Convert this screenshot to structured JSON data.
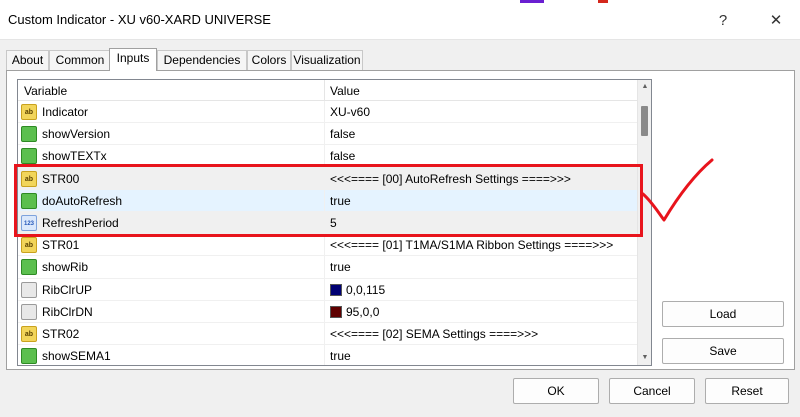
{
  "window": {
    "title": "Custom Indicator - XU v60-XARD UNIVERSE",
    "help_glyph": "?",
    "close_glyph": "✕"
  },
  "tabs": [
    {
      "label": "About"
    },
    {
      "label": "Common"
    },
    {
      "label": "Inputs"
    },
    {
      "label": "Dependencies"
    },
    {
      "label": "Colors"
    },
    {
      "label": "Visualization"
    }
  ],
  "active_tab": "Inputs",
  "grid": {
    "col_variable": "Variable",
    "col_value": "Value",
    "rows": [
      {
        "icon": "ab",
        "name": "Indicator",
        "value": "XU-v60"
      },
      {
        "icon": "bool",
        "name": "showVersion",
        "value": "false"
      },
      {
        "icon": "bool",
        "name": "showTEXTx",
        "value": "false"
      },
      {
        "icon": "ab",
        "name": "STR00",
        "value": "<<<==== [00] AutoRefresh Settings ====>>>"
      },
      {
        "icon": "bool",
        "name": "doAutoRefresh",
        "value": "true"
      },
      {
        "icon": "num",
        "name": "RefreshPeriod",
        "value": "5"
      },
      {
        "icon": "ab",
        "name": "STR01",
        "value": "<<<==== [01] T1MA/S1MA Ribbon Settings ====>>>"
      },
      {
        "icon": "bool",
        "name": "showRib",
        "value": "true"
      },
      {
        "icon": "color",
        "name": "RibClrUP",
        "value": "0,0,115",
        "swatch": "#000073"
      },
      {
        "icon": "color",
        "name": "RibClrDN",
        "value": "95,0,0",
        "swatch": "#5f0000"
      },
      {
        "icon": "ab",
        "name": "STR02",
        "value": "<<<==== [02] SEMA Settings ====>>>"
      },
      {
        "icon": "bool",
        "name": "showSEMA1",
        "value": "true"
      }
    ]
  },
  "icon_labels": {
    "ab": "ab",
    "num": "123"
  },
  "buttons": {
    "load": "Load",
    "save": "Save",
    "ok": "OK",
    "cancel": "Cancel",
    "reset": "Reset"
  },
  "colors": {
    "annotation": "#e8141c",
    "selection": "#e5f3ff"
  }
}
